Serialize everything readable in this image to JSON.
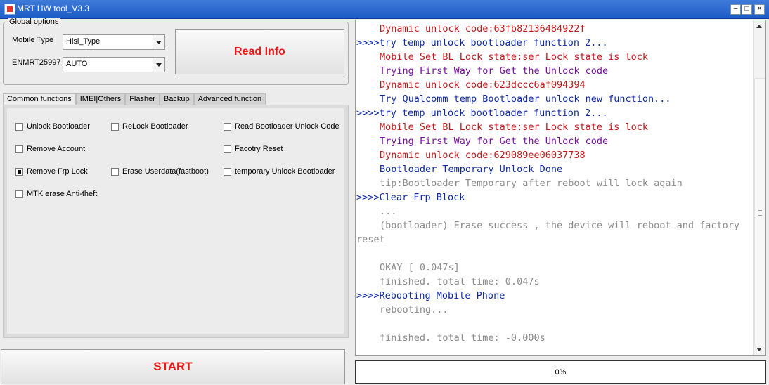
{
  "window": {
    "title": "MRT HW tool_V3.3"
  },
  "global_options": {
    "legend": "Global options",
    "mobile_type_label": "Mobile Type",
    "mobile_type_value": "Hisi_Type",
    "enmrt_label": "ENMRT25997",
    "enmrt_value": "AUTO",
    "read_info_label": "Read Info"
  },
  "tabs": [
    "Common functions",
    "IMEI|Others",
    "Flasher",
    "Backup",
    "Advanced function"
  ],
  "functions": [
    {
      "label": "Unlock Bootloader",
      "checked": false
    },
    {
      "label": "ReLock Bootloader",
      "checked": false
    },
    {
      "label": "Read Bootloader Unlock Code",
      "checked": false
    },
    {
      "label": "Remove Account",
      "checked": false
    },
    {
      "label": "Facotry Reset",
      "checked": false
    },
    {
      "label": "Remove Frp Lock",
      "checked": true
    },
    {
      "label": "Erase Userdata(fastboot)",
      "checked": false
    },
    {
      "label": "temporary Unlock Bootloader",
      "checked": false
    },
    {
      "label": "MTK erase Anti-theft",
      "checked": false
    }
  ],
  "start_label": "START",
  "log": [
    {
      "text": "Dynamic unlock code:63fb82136484922f",
      "color": "#c21a1a",
      "indent": true
    },
    {
      "text": ">>>>try temp unlock bootloader function 2...",
      "color": "#0e2aa6",
      "indent": false
    },
    {
      "text": "Mobile Set BL Lock state:ser Lock state is lock",
      "color": "#c21a1a",
      "indent": true
    },
    {
      "text": "Trying First Way for Get the Unlock code",
      "color": "#7a0fa0",
      "indent": true
    },
    {
      "text": "Dynamic unlock code:623dccc6af094394",
      "color": "#c21a1a",
      "indent": true
    },
    {
      "text": "Try Qualcomm temp Bootloader unlock new function...",
      "color": "#0e2aa6",
      "indent": true
    },
    {
      "text": ">>>>try temp unlock bootloader function 2...",
      "color": "#0e2aa6",
      "indent": false
    },
    {
      "text": "Mobile Set BL Lock state:ser Lock state is lock",
      "color": "#c21a1a",
      "indent": true
    },
    {
      "text": "Trying First Way for Get the Unlock code",
      "color": "#7a0fa0",
      "indent": true
    },
    {
      "text": "Dynamic unlock code:629089ee06037738",
      "color": "#c21a1a",
      "indent": true
    },
    {
      "text": "Bootloader Temporary  Unlock Done",
      "color": "#0e2aa6",
      "indent": true
    },
    {
      "text": "tip:Bootloader Temporary after reboot will lock again",
      "color": "#8a8a8a",
      "indent": true
    },
    {
      "text": ">>>>Clear Frp Block",
      "color": "#0e2aa6",
      "indent": false
    },
    {
      "text": "...",
      "color": "#8a8a8a",
      "indent": true
    },
    {
      "text": "(bootloader)  Erase success , the device will reboot and factory",
      "color": "#8a8a8a",
      "indent": true
    },
    {
      "text": "reset",
      "color": "#8a8a8a",
      "indent": false
    },
    {
      "text": "",
      "color": "#8a8a8a",
      "indent": false
    },
    {
      "text": "OKAY [  0.047s]",
      "color": "#8a8a8a",
      "indent": true
    },
    {
      "text": "finished. total time: 0.047s",
      "color": "#8a8a8a",
      "indent": true
    },
    {
      "text": ">>>>Rebooting Mobile Phone",
      "color": "#0e2aa6",
      "indent": false
    },
    {
      "text": "rebooting...",
      "color": "#8a8a8a",
      "indent": true
    },
    {
      "text": "",
      "color": "#8a8a8a",
      "indent": false
    },
    {
      "text": "finished. total time: -0.000s",
      "color": "#8a8a8a",
      "indent": true
    }
  ],
  "progress": {
    "label": "0%",
    "value": 0
  }
}
